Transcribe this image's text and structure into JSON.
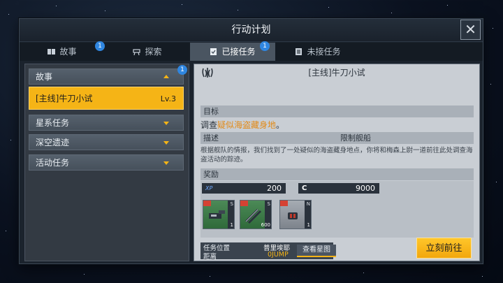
{
  "window": {
    "title": "行动计划",
    "close_icon": "close-icon"
  },
  "tabs": [
    {
      "label": "故事",
      "icon": "book-icon",
      "badge": "1",
      "active": false
    },
    {
      "label": "探索",
      "icon": "telescope-icon",
      "active": false
    },
    {
      "label": "已接任务",
      "icon": "clipboard-check-icon",
      "badge": "1",
      "active": true
    },
    {
      "label": "未接任务",
      "icon": "list-icon",
      "active": false
    }
  ],
  "sidebar": {
    "categories": [
      {
        "label": "故事",
        "badge": "1",
        "expanded": true
      },
      {
        "label": "星系任务",
        "expanded": false
      },
      {
        "label": "深空遗迹",
        "expanded": false
      },
      {
        "label": "活动任务",
        "expanded": false
      }
    ],
    "selected_mission": {
      "label": "[主线]牛刀小试",
      "level": "Lv.3"
    }
  },
  "detail": {
    "title": "[主线]牛刀小试",
    "goal_header": "目标",
    "goal_prefix": "调查",
    "goal_highlight": "疑似海盗藏身地",
    "goal_suffix": "。",
    "desc_header": "描述",
    "restrict_label": "限制舰船",
    "description": "根据舰队的情报，我们找到了一处疑似的海盗藏身地点，你将和梅森上尉一道前往此处调查海盗活动的踪迹。",
    "rewards_header": "奖励",
    "xp_label": "XP",
    "xp_value": "200",
    "credit_label": "C",
    "credit_value": "9000",
    "items": [
      {
        "tier": "S",
        "qty": "1",
        "color": "green",
        "icon": "cannon-weapon-icon"
      },
      {
        "tier": "S",
        "qty": "600",
        "color": "green",
        "icon": "missile-ammo-icon"
      },
      {
        "tier": "N",
        "qty": "1",
        "color": "grey",
        "icon": "engine-part-icon"
      }
    ],
    "location_label": "任务位置",
    "location_value": "普里埃耶",
    "distance_label": "距离",
    "distance_value": "0JUMP",
    "view_map_label": "查看星图",
    "go_label": "立刻前往"
  },
  "colors": {
    "accent": "#f5b416",
    "badge": "#2f86e0",
    "highlight_text": "#e28a17"
  }
}
